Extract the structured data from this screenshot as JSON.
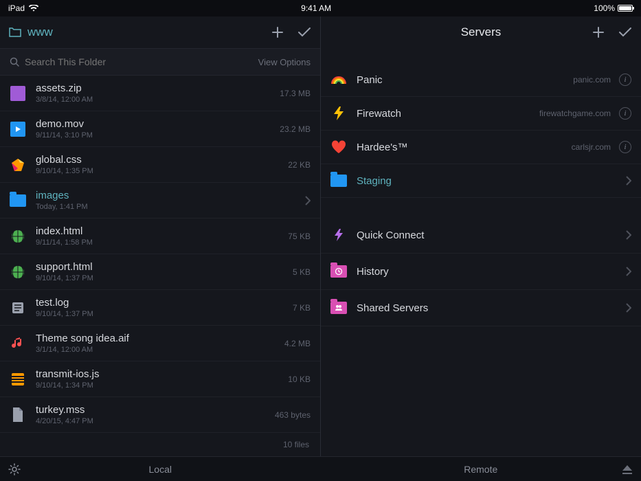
{
  "statusbar": {
    "device": "iPad",
    "time": "9:41 AM",
    "battery_pct": "100%"
  },
  "left_pane": {
    "title": "www",
    "search_placeholder": "Search This Folder",
    "view_options_label": "View Options",
    "files": [
      {
        "icon": "zip-icon",
        "name": "assets.zip",
        "meta": "3/8/14, 12:00 AM",
        "size": "17.3 MB"
      },
      {
        "icon": "movie-icon",
        "name": "demo.mov",
        "meta": "9/11/14, 3:10 PM",
        "size": "23.2 MB"
      },
      {
        "icon": "css-icon",
        "name": "global.css",
        "meta": "9/10/14, 1:35 PM",
        "size": "22 KB"
      },
      {
        "icon": "folder-icon",
        "name": "images",
        "meta": "Today, 1:41 PM",
        "size": "",
        "accent": true,
        "chevron": true
      },
      {
        "icon": "html-icon",
        "name": "index.html",
        "meta": "9/11/14, 1:58 PM",
        "size": "75 KB"
      },
      {
        "icon": "html-icon",
        "name": "support.html",
        "meta": "9/10/14, 1:37 PM",
        "size": "5 KB"
      },
      {
        "icon": "log-icon",
        "name": "test.log",
        "meta": "9/10/14, 1:37 PM",
        "size": "7 KB"
      },
      {
        "icon": "audio-icon",
        "name": "Theme song idea.aif",
        "meta": "3/1/14, 12:00 AM",
        "size": "4.2 MB"
      },
      {
        "icon": "js-icon",
        "name": "transmit-ios.js",
        "meta": "9/10/14, 1:34 PM",
        "size": "10 KB"
      },
      {
        "icon": "file-icon",
        "name": "turkey.mss",
        "meta": "4/20/15, 4:47 PM",
        "size": "463 bytes"
      }
    ],
    "summary": "10 files"
  },
  "right_pane": {
    "title": "Servers",
    "servers": [
      {
        "icon": "rainbow-icon",
        "name": "Panic",
        "host": "panic.com",
        "info": true
      },
      {
        "icon": "bolt-icon",
        "name": "Firewatch",
        "host": "firewatchgame.com",
        "info": true
      },
      {
        "icon": "heart-icon",
        "name": "Hardee's™",
        "host": "carlsjr.com",
        "info": true
      },
      {
        "icon": "folder-icon",
        "name": "Staging",
        "host": "",
        "accent": true,
        "chevron": true
      }
    ],
    "utilities": [
      {
        "icon": "bolt-small-icon",
        "label": "Quick Connect"
      },
      {
        "icon": "history-icon",
        "label": "History"
      },
      {
        "icon": "shared-icon",
        "label": "Shared Servers"
      }
    ]
  },
  "bottombar": {
    "left_label": "Local",
    "right_label": "Remote"
  }
}
